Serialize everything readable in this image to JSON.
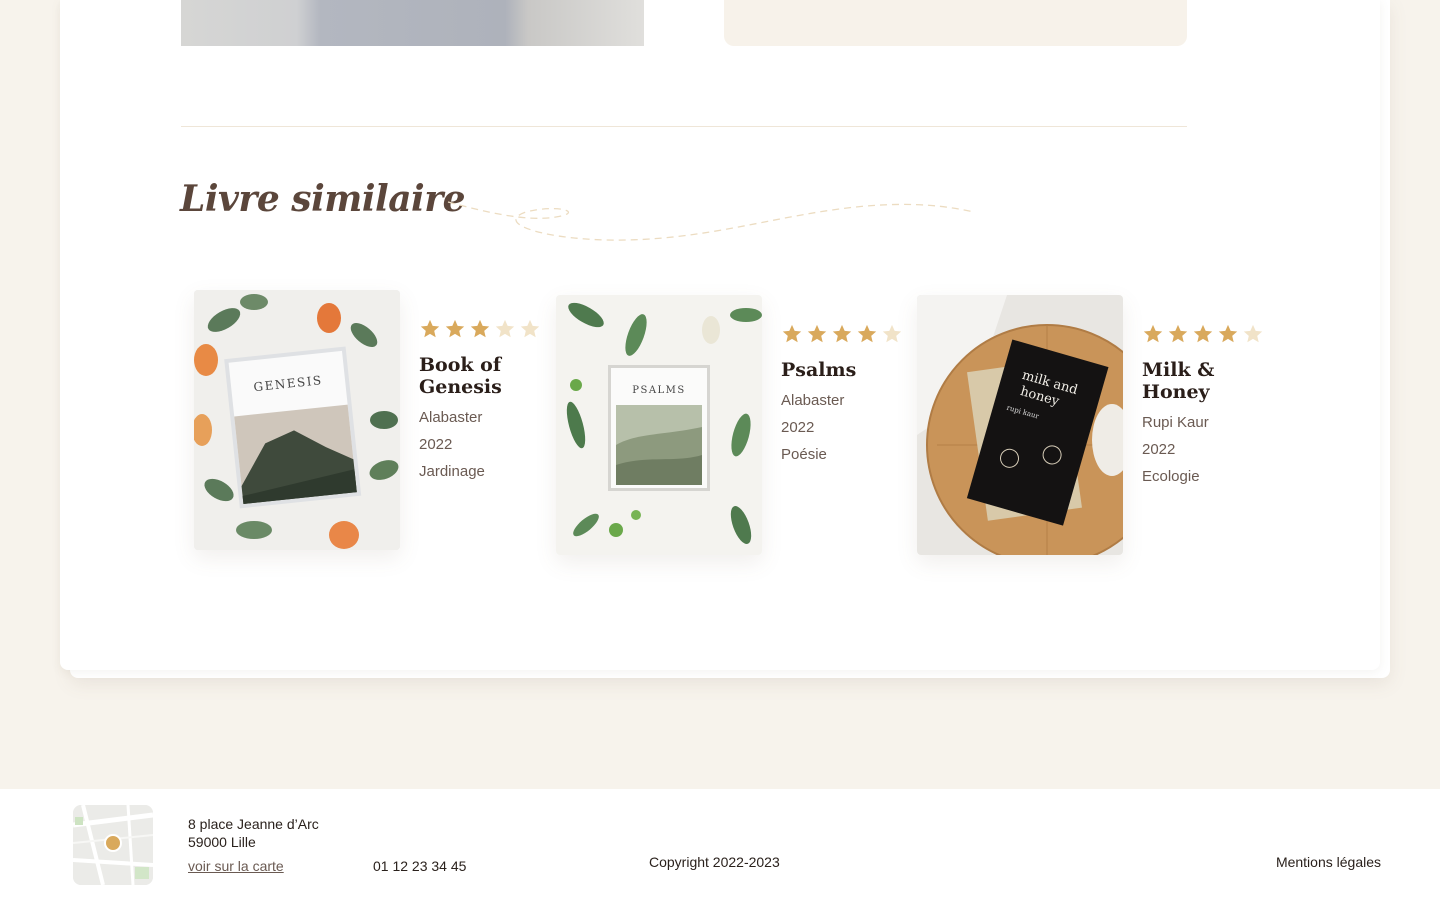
{
  "section": {
    "title": "Livre similaire"
  },
  "books": [
    {
      "title_line1": "Book of",
      "title_line2": "Genesis",
      "author": "Alabaster",
      "year": "2022",
      "category": "Jardinage",
      "rating": 3,
      "rating_max": 5,
      "cover_text": "GENESIS"
    },
    {
      "title_line1": "Psalms",
      "title_line2": "",
      "author": "Alabaster",
      "year": "2022",
      "category": "Poésie",
      "rating": 4,
      "rating_max": 5,
      "cover_text": "PSALMS"
    },
    {
      "title_line1": "Milk &",
      "title_line2": "Honey",
      "author": "Rupi Kaur",
      "year": "2022",
      "category": "Ecologie",
      "rating": 4,
      "rating_max": 5,
      "cover_text": "milk and honey",
      "cover_author": "rupi kaur"
    }
  ],
  "footer": {
    "address_line1": "8 place Jeanne d’Arc",
    "address_line2": "59000 Lille",
    "map_link": "voir sur la carte",
    "phone": "01 12 23 34 45",
    "copyright": "Copyright 2022-2023",
    "legal": "Mentions légales"
  },
  "colors": {
    "page_bg": "#f7f3ec",
    "star_filled": "#d9a95c",
    "star_empty": "#f1e3c8",
    "title_brown": "#5b463b"
  }
}
